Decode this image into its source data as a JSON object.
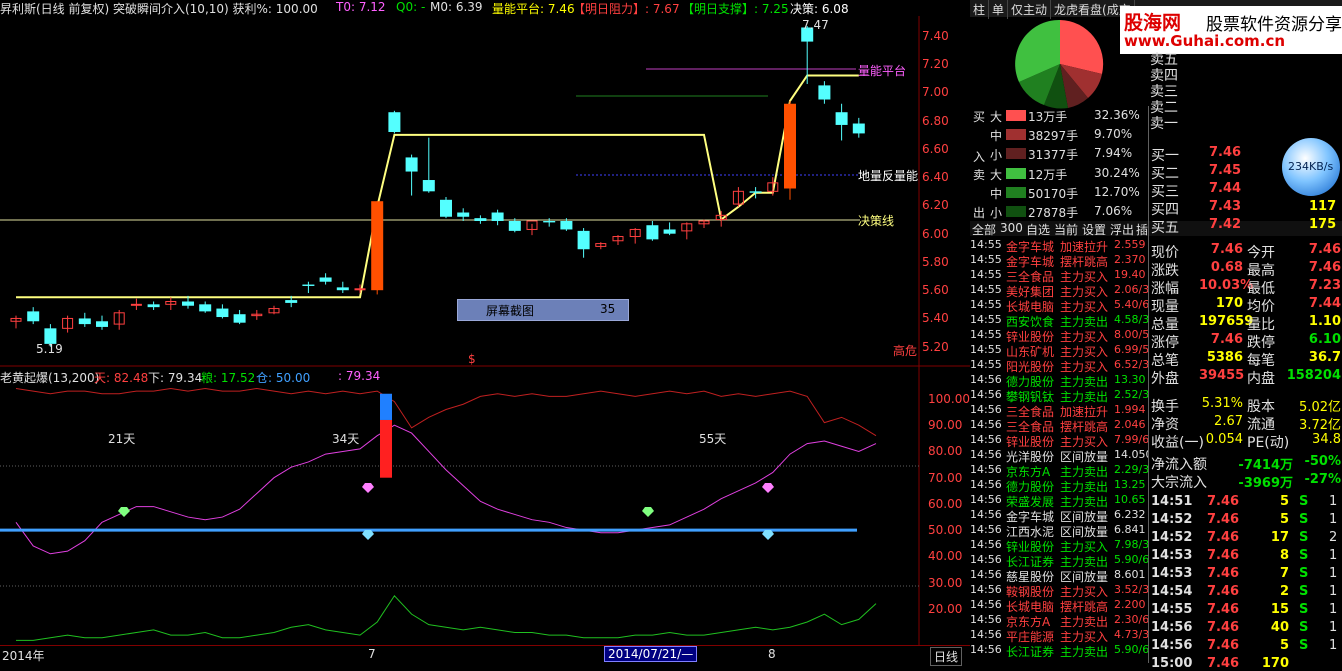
{
  "topbar": {
    "title": "昇利斯(日线 前复权) 突破瞬间介入(10,10) 获利%: 100.00",
    "t0": "T0: 7.12",
    "q0": "Q0: -",
    "m0": "M0: 6.39",
    "lnpt": "量能平台: 7.46",
    "resist": "【明日阻力】: 7.67",
    "support": "【明日支撑】: 7.25",
    "decision": "决策: 6.08"
  },
  "main_labels": {
    "peak": "7.47",
    "low": "5.19",
    "lnpt": "量能平台",
    "dl": "地量反量能",
    "jc": "决策线",
    "high_danger": "高危",
    "dollar": "$"
  },
  "screenshot_box": {
    "label": "屏幕截图",
    "value": "35"
  },
  "main_axis": [
    "7.40",
    "7.20",
    "7.00",
    "6.80",
    "6.60",
    "6.40",
    "6.20",
    "6.00",
    "5.80",
    "5.60",
    "5.40",
    "5.20"
  ],
  "sub_header": {
    "name": "老黄起爆(13,200)",
    "tian": "天: 82.48",
    "xia": "下: 79.34",
    "liang": "粮: 17.52",
    "cang": "仓: 50.00",
    "v": ": 79.34"
  },
  "sub_axis": [
    "100.00",
    "90.00",
    "80.00",
    "70.00",
    "60.00",
    "50.00",
    "40.00",
    "30.00",
    "20.00"
  ],
  "sub_labels": {
    "d21": "21天",
    "d34": "34天",
    "d55": "55天"
  },
  "bottom_axis": {
    "year": "2014年",
    "m7": "7",
    "date": "2014/07/21/—",
    "m8": "8",
    "rixian": "日线"
  },
  "right_panel": {
    "tabs": [
      "柱",
      "单",
      "仅主动",
      "龙虎看盘(成交"
    ],
    "logo": {
      "l1": "股海网",
      "l2": "股票软件资源分享",
      "l3": "www.Guhai.com.cn"
    },
    "sell_levels": [
      "卖五",
      "卖四",
      "卖三",
      "卖二",
      "卖一"
    ],
    "flow_buy_label": [
      "买",
      "入"
    ],
    "flow_sell_label": [
      "卖",
      "出"
    ],
    "flow_buy": [
      {
        "size": "大",
        "vol": "13万手",
        "pct": "32.36%",
        "color": "#ff5050"
      },
      {
        "size": "中",
        "vol": "38297手",
        "pct": "9.70%",
        "color": "#a03030"
      },
      {
        "size": "小",
        "vol": "31377手",
        "pct": "7.94%",
        "color": "#602020"
      }
    ],
    "flow_sell": [
      {
        "size": "大",
        "vol": "12万手",
        "pct": "30.24%",
        "color": "#40c040"
      },
      {
        "size": "中",
        "vol": "50170手",
        "pct": "12.70%",
        "color": "#208020"
      },
      {
        "size": "小",
        "vol": "27878手",
        "pct": "7.06%",
        "color": "#105010"
      }
    ],
    "menu": [
      "全部",
      "300",
      "自选",
      "当前",
      "设置",
      "浮出",
      "插"
    ],
    "speed": "234KB/s",
    "buy_levels": [
      {
        "label": "买一",
        "price": "7.46",
        "vol": ""
      },
      {
        "label": "买二",
        "price": "7.45",
        "vol": ""
      },
      {
        "label": "买三",
        "price": "7.44",
        "vol": "07"
      },
      {
        "label": "买四",
        "price": "7.43",
        "vol": "117"
      },
      {
        "label": "买五",
        "price": "7.42",
        "vol": "175"
      }
    ],
    "stats": [
      {
        "l": "现价",
        "v": "7.46",
        "l2": "今开",
        "v2": "7.46"
      },
      {
        "l": "涨跌",
        "v": "0.68",
        "l2": "最高",
        "v2": "7.46"
      },
      {
        "l": "涨幅",
        "v": "10.03%",
        "l2": "最低",
        "v2": "7.23"
      },
      {
        "l": "现量",
        "v": "170",
        "l2": "均价",
        "v2": "7.44"
      },
      {
        "l": "总量",
        "v": "197659",
        "l2": "量比",
        "v2": "1.10"
      },
      {
        "l": "涨停",
        "v": "7.46",
        "l2": "跌停",
        "v2": "6.10"
      },
      {
        "l": "总笔",
        "v": "5386",
        "l2": "每笔",
        "v2": "36.7"
      },
      {
        "l": "外盘",
        "v": "39455",
        "l2": "内盘",
        "v2": "158204"
      }
    ],
    "stats2": [
      {
        "l": "换手",
        "v": "5.31%",
        "l2": "股本",
        "v2": "5.02亿"
      },
      {
        "l": "净资",
        "v": "2.67",
        "l2": "流通",
        "v2": "3.72亿"
      },
      {
        "l": "收益(一)",
        "v": "0.054",
        "l2": "PE(动)",
        "v2": "34.8"
      }
    ],
    "netflow": [
      {
        "l": "净流入额",
        "v": "-7414万",
        "p": "-50%"
      },
      {
        "l": "大宗流入",
        "v": "-3969万",
        "p": "-27%"
      }
    ],
    "ticks": [
      {
        "t": "14:51",
        "p": "7.46",
        "v": "5",
        "d": "S",
        "n": "1"
      },
      {
        "t": "14:52",
        "p": "7.46",
        "v": "5",
        "d": "S",
        "n": "1"
      },
      {
        "t": "14:52",
        "p": "7.46",
        "v": "17",
        "d": "S",
        "n": "2"
      },
      {
        "t": "14:53",
        "p": "7.46",
        "v": "8",
        "d": "S",
        "n": "1"
      },
      {
        "t": "14:53",
        "p": "7.46",
        "v": "7",
        "d": "S",
        "n": "1"
      },
      {
        "t": "14:54",
        "p": "7.46",
        "v": "2",
        "d": "S",
        "n": "1"
      },
      {
        "t": "14:55",
        "p": "7.46",
        "v": "15",
        "d": "S",
        "n": "1"
      },
      {
        "t": "14:56",
        "p": "7.46",
        "v": "40",
        "d": "S",
        "n": "1"
      },
      {
        "t": "14:56",
        "p": "7.46",
        "v": "5",
        "d": "S",
        "n": "1"
      },
      {
        "t": "15:00",
        "p": "7.46",
        "v": "170",
        "d": "",
        "n": ""
      }
    ],
    "news": [
      {
        "t": "14:55",
        "s": "金字车城",
        "k": "加速拉升",
        "v": "2.559",
        "c": "red"
      },
      {
        "t": "14:55",
        "s": "金字车城",
        "k": "摆杆跳高",
        "v": "2.370",
        "c": "red"
      },
      {
        "t": "14:55",
        "s": "三全食品",
        "k": "主力买入",
        "v": "19.40",
        "c": "red"
      },
      {
        "t": "14:55",
        "s": "美好集团",
        "k": "主力买入",
        "v": "2.06/3",
        "c": "red"
      },
      {
        "t": "14:55",
        "s": "长城电脑",
        "k": "主力买入",
        "v": "5.40/6",
        "c": "red"
      },
      {
        "t": "14:55",
        "s": "西安饮食",
        "k": "主力卖出",
        "v": "4.58/3",
        "c": "green"
      },
      {
        "t": "14:55",
        "s": "锌业股份",
        "k": "主力买入",
        "v": "8.00/5",
        "c": "red"
      },
      {
        "t": "14:55",
        "s": "山东矿机",
        "k": "主力买入",
        "v": "6.99/5",
        "c": "red"
      },
      {
        "t": "14:55",
        "s": "阳光股份",
        "k": "主力买入",
        "v": "6.52/3",
        "c": "red"
      },
      {
        "t": "14:56",
        "s": "德力股份",
        "k": "主力卖出",
        "v": "13.30",
        "c": "green"
      },
      {
        "t": "14:56",
        "s": "攀钢钒钛",
        "k": "主力卖出",
        "v": "2.52/3",
        "c": "green"
      },
      {
        "t": "14:56",
        "s": "三全食品",
        "k": "加速拉升",
        "v": "1.994",
        "c": "red"
      },
      {
        "t": "14:56",
        "s": "三全食品",
        "k": "摆杆跳高",
        "v": "2.046",
        "c": "red"
      },
      {
        "t": "14:56",
        "s": "锌业股份",
        "k": "主力买入",
        "v": "7.99/6",
        "c": "red"
      },
      {
        "t": "14:56",
        "s": "光洋股份",
        "k": "区间放量",
        "v": "14.050",
        "c": "white"
      },
      {
        "t": "14:56",
        "s": "京东方A",
        "k": "主力卖出",
        "v": "2.29/3",
        "c": "green"
      },
      {
        "t": "14:56",
        "s": "德力股份",
        "k": "主力卖出",
        "v": "13.25",
        "c": "green"
      },
      {
        "t": "14:56",
        "s": "荣盛发展",
        "k": "主力卖出",
        "v": "10.65",
        "c": "green"
      },
      {
        "t": "14:56",
        "s": "金字车城",
        "k": "区间放量",
        "v": "6.232",
        "c": "white"
      },
      {
        "t": "14:56",
        "s": "江西水泥",
        "k": "区间放量",
        "v": "6.841",
        "c": "white"
      },
      {
        "t": "14:56",
        "s": "锌业股份",
        "k": "主力买入",
        "v": "7.98/3",
        "c": "green"
      },
      {
        "t": "14:56",
        "s": "长江证券",
        "k": "主力卖出",
        "v": "5.90/6",
        "c": "green"
      },
      {
        "t": "14:56",
        "s": "慈星股份",
        "k": "区间放量",
        "v": "8.601",
        "c": "white"
      },
      {
        "t": "14:56",
        "s": "鞍钢股份",
        "k": "主力买入",
        "v": "3.52/3",
        "c": "red"
      },
      {
        "t": "14:56",
        "s": "长城电脑",
        "k": "摆杆跳高",
        "v": "2.200",
        "c": "red"
      },
      {
        "t": "14:56",
        "s": "京东方A",
        "k": "主力卖出",
        "v": "2.30/6",
        "c": "red"
      },
      {
        "t": "14:56",
        "s": "平庄能源",
        "k": "主力买入",
        "v": "4.73/3",
        "c": "red"
      },
      {
        "t": "14:56",
        "s": "长江证券",
        "k": "主力卖出",
        "v": "5.90/6",
        "c": "green"
      }
    ]
  },
  "chart_data": {
    "type": "candlestick",
    "main_ylim": [
      5.12,
      7.52
    ],
    "candles": [
      {
        "o": 5.38,
        "h": 5.42,
        "l": 5.33,
        "c": 5.4
      },
      {
        "o": 5.45,
        "h": 5.48,
        "l": 5.36,
        "c": 5.38
      },
      {
        "o": 5.33,
        "h": 5.36,
        "l": 5.2,
        "c": 5.22
      },
      {
        "o": 5.33,
        "h": 5.42,
        "l": 5.3,
        "c": 5.4
      },
      {
        "o": 5.4,
        "h": 5.44,
        "l": 5.34,
        "c": 5.36
      },
      {
        "o": 5.38,
        "h": 5.42,
        "l": 5.32,
        "c": 5.34
      },
      {
        "o": 5.36,
        "h": 5.46,
        "l": 5.32,
        "c": 5.44
      },
      {
        "o": 5.5,
        "h": 5.54,
        "l": 5.46,
        "c": 5.5
      },
      {
        "o": 5.5,
        "h": 5.52,
        "l": 5.46,
        "c": 5.48
      },
      {
        "o": 5.5,
        "h": 5.55,
        "l": 5.46,
        "c": 5.52
      },
      {
        "o": 5.52,
        "h": 5.56,
        "l": 5.47,
        "c": 5.49
      },
      {
        "o": 5.5,
        "h": 5.52,
        "l": 5.44,
        "c": 5.45
      },
      {
        "o": 5.47,
        "h": 5.5,
        "l": 5.4,
        "c": 5.41
      },
      {
        "o": 5.43,
        "h": 5.46,
        "l": 5.36,
        "c": 5.37
      },
      {
        "o": 5.42,
        "h": 5.46,
        "l": 5.39,
        "c": 5.43
      },
      {
        "o": 5.44,
        "h": 5.49,
        "l": 5.43,
        "c": 5.47
      },
      {
        "o": 5.53,
        "h": 5.56,
        "l": 5.48,
        "c": 5.51
      },
      {
        "o": 5.64,
        "h": 5.66,
        "l": 5.58,
        "c": 5.63
      },
      {
        "o": 5.69,
        "h": 5.72,
        "l": 5.64,
        "c": 5.66
      },
      {
        "o": 5.62,
        "h": 5.66,
        "l": 5.58,
        "c": 5.6
      },
      {
        "o": 5.61,
        "h": 5.64,
        "l": 5.58,
        "c": 5.61
      },
      {
        "o": 5.6,
        "h": 6.23,
        "l": 5.57,
        "c": 6.23
      },
      {
        "o": 6.86,
        "h": 6.87,
        "l": 6.71,
        "c": 6.72
      },
      {
        "o": 6.54,
        "h": 6.56,
        "l": 6.27,
        "c": 6.44
      },
      {
        "o": 6.38,
        "h": 6.68,
        "l": 6.29,
        "c": 6.3
      },
      {
        "o": 6.24,
        "h": 6.26,
        "l": 6.11,
        "c": 6.12
      },
      {
        "o": 6.15,
        "h": 6.18,
        "l": 6.09,
        "c": 6.12
      },
      {
        "o": 6.11,
        "h": 6.13,
        "l": 6.07,
        "c": 6.09
      },
      {
        "o": 6.15,
        "h": 6.17,
        "l": 6.06,
        "c": 6.09
      },
      {
        "o": 6.09,
        "h": 6.11,
        "l": 6.01,
        "c": 6.02
      },
      {
        "o": 6.03,
        "h": 6.07,
        "l": 5.99,
        "c": 6.09
      },
      {
        "o": 6.09,
        "h": 6.11,
        "l": 6.05,
        "c": 6.08
      },
      {
        "o": 6.09,
        "h": 6.11,
        "l": 6.02,
        "c": 6.03
      },
      {
        "o": 6.02,
        "h": 6.04,
        "l": 5.83,
        "c": 5.89
      },
      {
        "o": 5.91,
        "h": 5.94,
        "l": 5.89,
        "c": 5.93
      },
      {
        "o": 5.95,
        "h": 5.99,
        "l": 5.92,
        "c": 5.98
      },
      {
        "o": 5.98,
        "h": 6.04,
        "l": 5.93,
        "c": 6.03
      },
      {
        "o": 6.06,
        "h": 6.09,
        "l": 5.95,
        "c": 5.96
      },
      {
        "o": 6.03,
        "h": 6.08,
        "l": 5.99,
        "c": 6.0
      },
      {
        "o": 6.02,
        "h": 6.08,
        "l": 5.96,
        "c": 6.07
      },
      {
        "o": 6.07,
        "h": 6.1,
        "l": 6.04,
        "c": 6.09
      },
      {
        "o": 6.1,
        "h": 6.16,
        "l": 6.05,
        "c": 6.13
      },
      {
        "o": 6.21,
        "h": 6.33,
        "l": 6.19,
        "c": 6.3
      },
      {
        "o": 6.3,
        "h": 6.33,
        "l": 6.25,
        "c": 6.29
      },
      {
        "o": 6.3,
        "h": 6.4,
        "l": 6.27,
        "c": 6.36
      },
      {
        "o": 6.32,
        "h": 6.94,
        "l": 6.24,
        "c": 6.92
      },
      {
        "o": 7.46,
        "h": 7.47,
        "l": 7.06,
        "c": 7.36
      },
      {
        "o": 7.05,
        "h": 7.08,
        "l": 6.92,
        "c": 6.95
      },
      {
        "o": 6.86,
        "h": 6.92,
        "l": 6.66,
        "c": 6.77
      },
      {
        "o": 6.78,
        "h": 6.82,
        "l": 6.68,
        "c": 6.71
      }
    ],
    "pivot_line": [
      5.55,
      5.55,
      5.55,
      5.55,
      5.55,
      5.55,
      5.55,
      5.55,
      5.55,
      5.55,
      5.55,
      5.55,
      5.55,
      5.55,
      5.55,
      5.55,
      5.55,
      5.55,
      5.55,
      5.55,
      5.55,
      6.19,
      6.7,
      6.7,
      6.7,
      6.7,
      6.7,
      6.7,
      6.7,
      6.7,
      6.7,
      6.7,
      6.7,
      6.7,
      6.7,
      6.7,
      6.7,
      6.7,
      6.7,
      6.7,
      6.7,
      6.1,
      6.19,
      6.29,
      6.29,
      6.94,
      7.12,
      7.12,
      7.12,
      7.12
    ],
    "sub_ylim": [
      7,
      108
    ],
    "tian": [
      104,
      103,
      102,
      103,
      103,
      102,
      102,
      103,
      103,
      104,
      103,
      104,
      103,
      103,
      104,
      103,
      102,
      103,
      102,
      103,
      102,
      103,
      99,
      89,
      93,
      96,
      98,
      101,
      102,
      101,
      102,
      101,
      101,
      102,
      103,
      102,
      101,
      102,
      103,
      102,
      103,
      101,
      102,
      101,
      102,
      103,
      101,
      91,
      93,
      90,
      86
    ],
    "pink": [
      53,
      44,
      41,
      42,
      46,
      53,
      56,
      59,
      59,
      57,
      55,
      54,
      55,
      58,
      64,
      70,
      74,
      76,
      79,
      80,
      81,
      86,
      90,
      87,
      80,
      73,
      67,
      61,
      58,
      56,
      54,
      53,
      51,
      50,
      49,
      49,
      50,
      51,
      52,
      55,
      58,
      62,
      65,
      68,
      72,
      79,
      83,
      84,
      82,
      80,
      83
    ],
    "green_line": [
      8,
      8,
      9,
      10,
      9,
      9,
      10,
      11,
      12,
      10,
      10,
      11,
      9,
      9,
      10,
      11,
      13,
      14,
      12,
      11,
      10,
      15,
      25,
      18,
      14,
      13,
      12,
      13,
      12,
      11,
      11,
      10,
      10,
      9,
      9,
      9,
      10,
      10,
      11,
      10,
      10,
      11,
      12,
      13,
      12,
      13,
      15,
      18,
      14,
      16,
      22
    ]
  }
}
